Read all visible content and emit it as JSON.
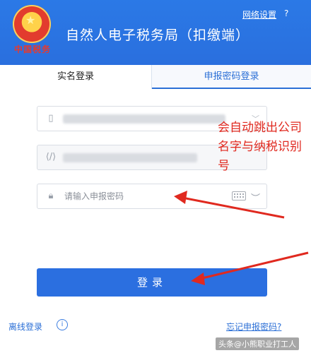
{
  "header": {
    "emblem_text": "中国税务",
    "app_title": "自然人电子税务局（扣缴端）",
    "network_settings": "网络设置",
    "help": "?"
  },
  "tabs": [
    {
      "label": "实名登录",
      "active": false
    },
    {
      "label": "申报密码登录",
      "active": true
    }
  ],
  "form": {
    "password_placeholder": "请输入申报密码",
    "login_label": "登录"
  },
  "footer": {
    "offline_login": "离线登录",
    "info": "i",
    "forgot_password": "忘记申报密码?",
    "watermark": "头条@小熊职业打工人"
  },
  "annotation": {
    "text": "会自动跳出公司名字与纳税识别号"
  },
  "colors": {
    "primary": "#2b6fe0",
    "header": "#2b79e6",
    "annotation": "#e0291f"
  }
}
